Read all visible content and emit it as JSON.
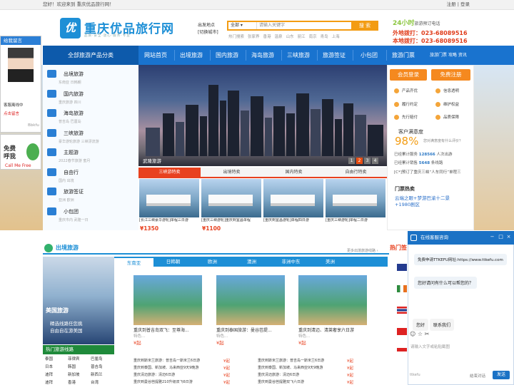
{
  "topbar": {
    "welcome": "您好！欢迎来到 重庆优品旅行网！",
    "login": "注册 | 登录"
  },
  "header": {
    "logo_mark": "优",
    "logo": "重庆优品旅行网",
    "slogan": "品质·安全·放心·服务·专业",
    "city_label": "出发地点",
    "city_switch": "[切换城市]",
    "search": {
      "category": "全部",
      "placeholder": "请输入关键字",
      "button": "搜 索"
    },
    "hot": [
      "热门搜索",
      "张家界",
      "香港",
      "温泉",
      "山东",
      "丽江",
      "南京",
      "青岛",
      "上海"
    ],
    "hotline": "24小时",
    "hotline_desc": "旅游预订电话",
    "phone1": "外地拨打：023-68089516",
    "phone2": "本地拨打：023-68089516"
  },
  "nav": {
    "all": "全部旅游产品分类",
    "items": [
      "网站首页",
      "出境旅游",
      "国内旅游",
      "海岛旅游",
      "三峡旅游",
      "旅游签证",
      "小包团",
      "旅游门票"
    ],
    "extra": "旅游门票  攻略  资讯"
  },
  "sidebar": [
    {
      "title": "出境旅游",
      "sub": "东南亚  日韩朝"
    },
    {
      "title": "国内旅游",
      "sub": "重庆旅游  四川"
    },
    {
      "title": "海岛旅游",
      "sub": "普吉岛  巴厘岛"
    },
    {
      "title": "三峡旅游",
      "sub": "豪华游轮旅游  三峡漂流游"
    },
    {
      "title": "主题游",
      "sub": "2022春节旅游  蜜月"
    },
    {
      "title": "自由行",
      "sub": "国内  出境"
    },
    {
      "title": "旅游签证",
      "sub": "亚洲  欧洲"
    },
    {
      "title": "小包团",
      "sub": "重庆市内  武隆一日"
    }
  ],
  "banner": {
    "caption": "武隆旅游",
    "dots": [
      "1",
      "2",
      "3",
      "4"
    ]
  },
  "tabs": [
    "三峡游特卖",
    "出境特卖",
    "国内特卖",
    "自由行特卖"
  ],
  "ships": [
    {
      "cap": "[长江三峡豪华游轮]单程三日游",
      "price": "¥1350"
    },
    {
      "cap": "[重庆三峡游轮]重庆到宜昌单程",
      "price": "¥1100"
    },
    {
      "cap": "[重庆到宜昌游轮]单程四日游",
      "price": ""
    },
    {
      "cap": "[重庆三峡游轮]单程二日游",
      "price": ""
    }
  ],
  "account": {
    "login": "会员登录",
    "register": "免费注册",
    "features": [
      "产品齐优",
      "信息透明",
      "履行约定",
      "维护权益",
      "先行赔付",
      "品质保障"
    ],
    "sat_title": "客户满意度",
    "sat_value": "98%",
    "sat_sub": "您对满意度有什么评价？",
    "served": "已经累计服务",
    "served_n": "128566",
    "served_u": "人次出游",
    "sold": "已经累计销售",
    "sold_n": "5648",
    "sold_u": "条线路",
    "marquee": "[C*]预订了重庆三峡“人车同行”单程三",
    "ticket_title": "门票热卖",
    "ticket_text": "云端之眼+梦游巴渝十二景+1980剧区"
  },
  "float_left": {
    "title": "给我留言",
    "row1": "客服离线中",
    "row2": "点击留言",
    "brand": "Bbkfu"
  },
  "callfree": {
    "line1": "免费",
    "line2": "呼我",
    "tag": "Call Me Free"
  },
  "outbound": {
    "title": "出境旅游",
    "more": "更多出境旅游线路 ›",
    "tabs": [
      "东南亚",
      "日韩朝",
      "欧洲",
      "澳洲",
      "非洲中东",
      "美洲"
    ],
    "statue": {
      "title": "美国旅游",
      "line1": "精选线路任您挑",
      "line2": "自由自在游美国"
    },
    "hotline_title": "热门旅游线路",
    "dests": [
      "泰国",
      "菲律宾",
      "巴厘岛",
      "日本",
      "韩国",
      "普吉岛",
      "迪拜",
      "新加坡",
      "新西兰",
      "迪拜",
      "香港",
      "台湾"
    ],
    "cards": [
      {
        "title": "重庆到普吉岛双飞：至尊海...",
        "sub": "特色...",
        "price": "¥起"
      },
      {
        "title": "重庆到泰国旅游：曼谷芭提...",
        "sub": "特色...",
        "price": "¥起"
      },
      {
        "title": "重庆到清迈、清莱奢享六日游",
        "sub": "特色...",
        "price": "¥起"
      }
    ],
    "lines_left": [
      "重庆到斯米兰旅游：普吉岛一斯米兰6日游",
      "重庆到泰国、新加坡、马来西亚9天9晚游",
      "重庆清迈旅游：清迈6日游",
      "重庆到曼谷芭提雅210升级双飞6日游"
    ],
    "lines_right": [
      "重庆到斯米兰旅游：普吉岛一斯米兰6日游",
      "重庆到泰国、新加坡、马来西亚9天9晚游",
      "重庆清迈旅游：清迈6日游",
      "重庆到曼谷芭提雅双飞六日游"
    ],
    "line_price": "¥起"
  },
  "right_head": "热门签",
  "chat": {
    "title": "在线客服咨询",
    "msg1": "免费申请TTKEFU网址:https://www.ttkefu.com",
    "msg2": "您好请问有什么可以帮您的？",
    "quick1": "您好",
    "quick2": "联系我们",
    "placeholder": "请输入文字或粘贴截图",
    "brand": "ttkefu",
    "end": "结束对话",
    "send": "发送"
  },
  "colors": {
    "brand": "#1d8fd6",
    "nav": "#1973cf",
    "accent": "#f39c12",
    "price": "#e8411f"
  }
}
